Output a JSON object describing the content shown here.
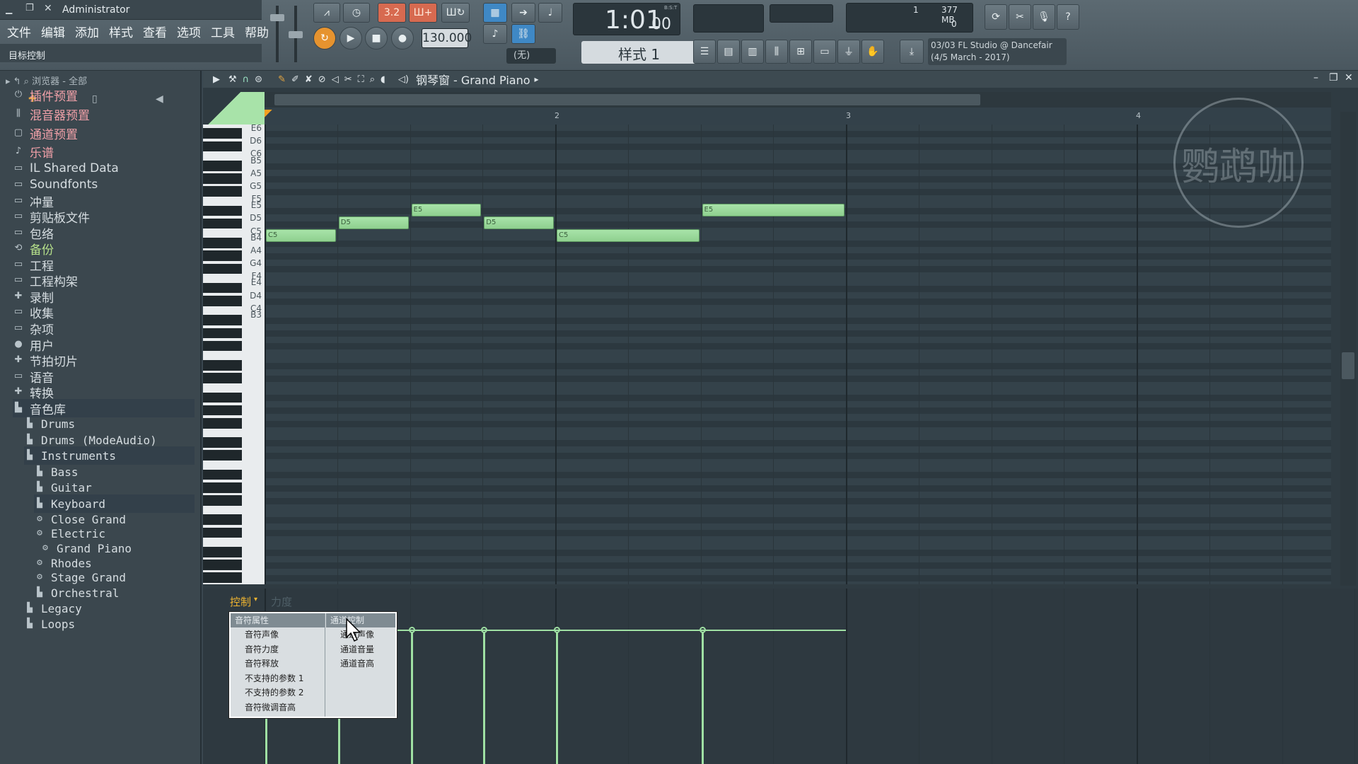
{
  "window": {
    "user": "Administrator",
    "hint": "目标控制"
  },
  "menu": [
    "文件",
    "编辑",
    "添加",
    "样式",
    "查看",
    "选项",
    "工具",
    "帮助"
  ],
  "transport": {
    "tempo": "130.000",
    "time": "1:01",
    "time_sub": "00",
    "bst": "B:S:T",
    "pattern": "样式 1",
    "none_label": "(无)",
    "pattern_mode": "3.2"
  },
  "monitor": {
    "cpu": "1",
    "mem": "377 MB",
    "poly": "0"
  },
  "news": {
    "line1": "03/03  FL Studio @ Dancefair",
    "line2": "(4/5 March - 2017)"
  },
  "browser": {
    "path": "浏览器 - 全部",
    "items": [
      {
        "label": "插件预置",
        "icon": "plug"
      },
      {
        "label": "混音器预置",
        "icon": "mixer"
      },
      {
        "label": "通道预置",
        "icon": "channel"
      },
      {
        "label": "乐谱",
        "icon": "note"
      },
      {
        "label": "IL Shared Data",
        "icon": "folder"
      },
      {
        "label": "Soundfonts",
        "icon": "folder"
      },
      {
        "label": "冲量",
        "icon": "folder"
      },
      {
        "label": "剪贴板文件",
        "icon": "folder"
      },
      {
        "label": "包络",
        "icon": "folder"
      },
      {
        "label": "备份",
        "icon": "folder-special"
      },
      {
        "label": "工程",
        "icon": "folder"
      },
      {
        "label": "工程构架",
        "icon": "folder"
      },
      {
        "label": "录制",
        "icon": "record"
      },
      {
        "label": "收集",
        "icon": "folder"
      },
      {
        "label": "杂项",
        "icon": "folder"
      },
      {
        "label": "用户",
        "icon": "user"
      },
      {
        "label": "节拍切片",
        "icon": "slice"
      },
      {
        "label": "语音",
        "icon": "folder"
      },
      {
        "label": "转换",
        "icon": "convert"
      },
      {
        "label": "音色库",
        "icon": "library"
      },
      {
        "label": "Drums",
        "icon": "library"
      },
      {
        "label": "Drums (ModeAudio)",
        "icon": "library"
      },
      {
        "label": "Instruments",
        "icon": "library"
      },
      {
        "label": "Bass",
        "icon": "library"
      },
      {
        "label": "Guitar",
        "icon": "library"
      },
      {
        "label": "Keyboard",
        "icon": "library"
      },
      {
        "label": "Close Grand",
        "icon": "preset"
      },
      {
        "label": "Electric",
        "icon": "preset"
      },
      {
        "label": "Grand Piano",
        "icon": "preset"
      },
      {
        "label": "Rhodes",
        "icon": "preset"
      },
      {
        "label": "Stage Grand",
        "icon": "preset"
      },
      {
        "label": "Orchestral",
        "icon": "library"
      },
      {
        "label": "Legacy",
        "icon": "library"
      },
      {
        "label": "Loops",
        "icon": "library"
      }
    ]
  },
  "piano_roll": {
    "title": "钢琴窗 - Grand Piano",
    "bars": [
      "2",
      "3",
      "4"
    ],
    "keys": [
      "E6",
      "D6",
      "C6",
      "B5",
      "A5",
      "G5",
      "F5",
      "E5",
      "D5",
      "C5",
      "B4",
      "A4",
      "G4",
      "F4",
      "E4",
      "D4",
      "C4",
      "B3"
    ],
    "notes": [
      {
        "pitch": "C5",
        "start": 1,
        "length": 1
      },
      {
        "pitch": "D5",
        "start": 2,
        "length": 1
      },
      {
        "pitch": "E5",
        "start": 3,
        "length": 1
      },
      {
        "pitch": "D5",
        "start": 4,
        "length": 1
      },
      {
        "pitch": "C5",
        "start": 5,
        "length": 2
      },
      {
        "pitch": "E5",
        "start": 7,
        "length": 2
      }
    ],
    "event_tab": "控制",
    "event_tab2": "力度"
  },
  "context_menu": {
    "col1_header": "音符属性",
    "col1": [
      "音符声像",
      "音符力度",
      "音符释放",
      "不支持的参数 1",
      "不支持的参数 2",
      "音符微调音高"
    ],
    "col2_header": "通道控制",
    "col2": [
      "通道声像",
      "通道音量",
      "通道音高"
    ]
  },
  "watermark": "鹦鹉咖"
}
